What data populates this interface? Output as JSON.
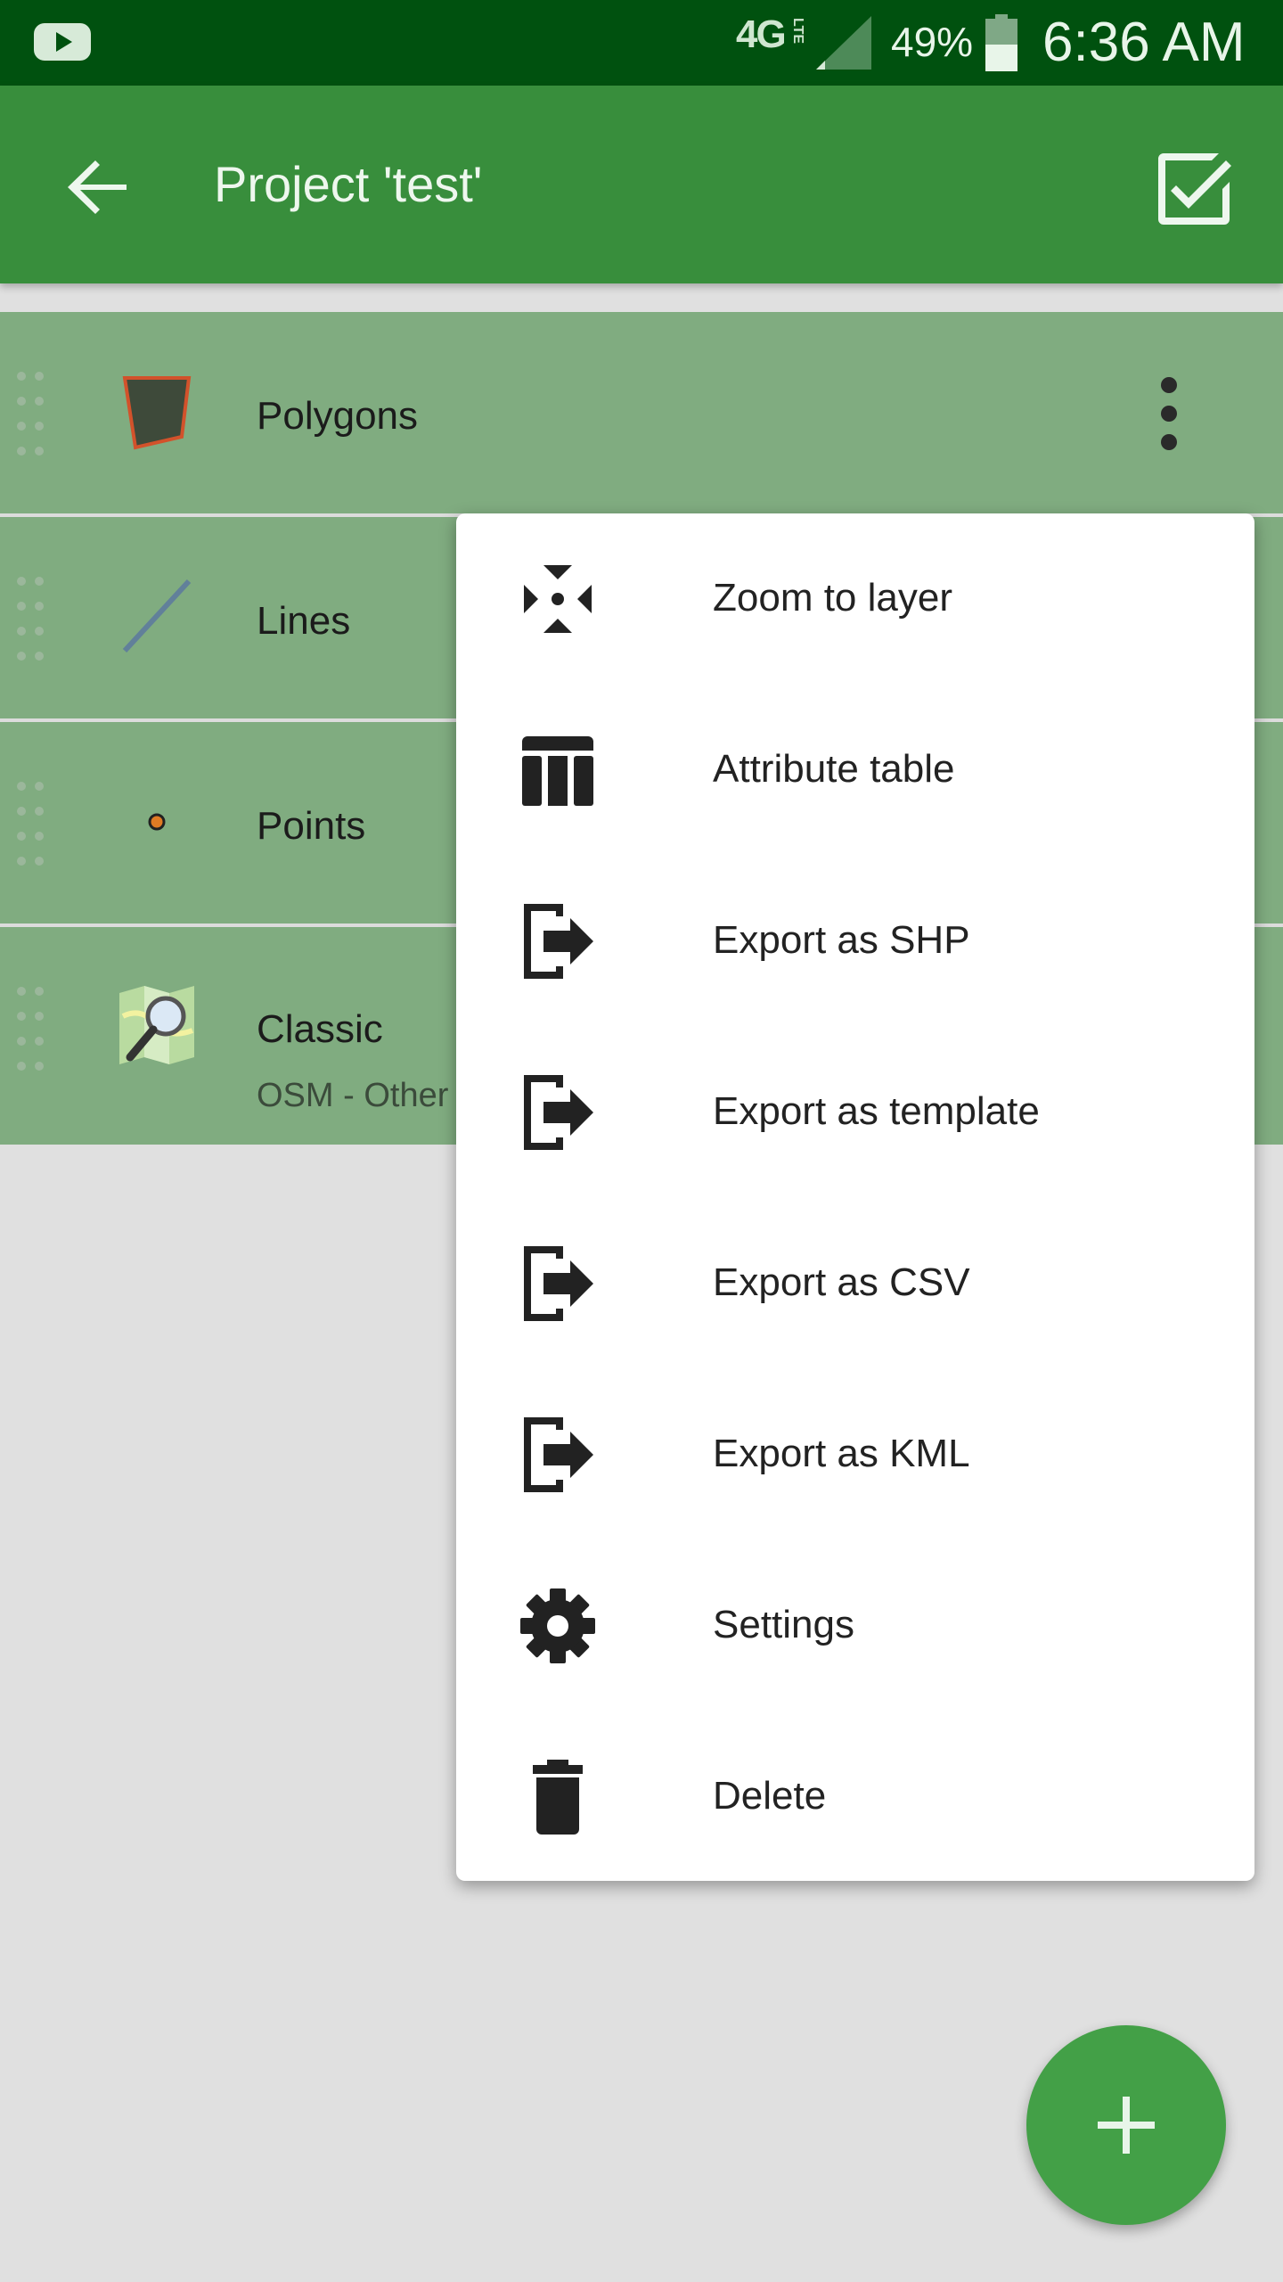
{
  "status_bar": {
    "network": "4G",
    "network_sub": "LTE",
    "battery": "49%",
    "time": "6:36 AM"
  },
  "app_bar": {
    "title": "Project 'test'"
  },
  "layers": [
    {
      "name": "Polygons",
      "subtitle": ""
    },
    {
      "name": "Lines",
      "subtitle": ""
    },
    {
      "name": "Points",
      "subtitle": ""
    },
    {
      "name": "Classic",
      "subtitle": "OSM - Other"
    }
  ],
  "menu": {
    "items": [
      {
        "label": "Zoom to layer",
        "icon": "zoom-to-extent-icon"
      },
      {
        "label": "Attribute table",
        "icon": "table-icon"
      },
      {
        "label": "Export as SHP",
        "icon": "export-icon"
      },
      {
        "label": "Export as template",
        "icon": "export-icon"
      },
      {
        "label": "Export as CSV",
        "icon": "export-icon"
      },
      {
        "label": "Export as KML",
        "icon": "export-icon"
      },
      {
        "label": "Settings",
        "icon": "gear-icon"
      },
      {
        "label": "Delete",
        "icon": "trash-icon"
      }
    ]
  },
  "colors": {
    "status_bar": "#00510f",
    "app_bar": "#388e3c",
    "layer_row": "#80ac80",
    "fab": "#43a047"
  }
}
